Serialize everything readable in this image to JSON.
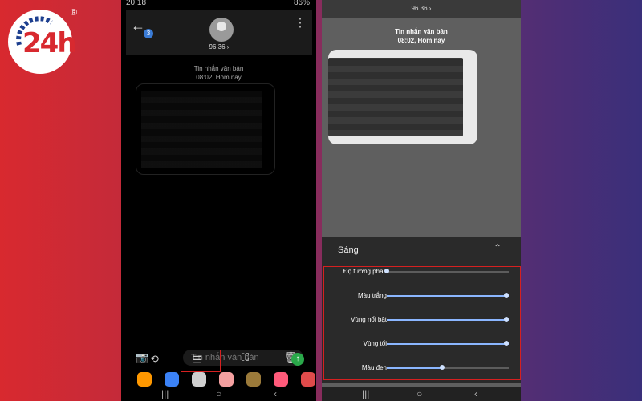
{
  "logo": {
    "brand_text": "24h",
    "reg": "®"
  },
  "left_phone": {
    "status": {
      "time": "20:18",
      "battery": "86%"
    },
    "header": {
      "contact": "96 36 ›",
      "badge": "3"
    },
    "thread_meta": {
      "title": "Tin nhắn văn bản",
      "time": "08:02, Hôm nay"
    },
    "composer": {
      "placeholder": "Tin nhắn văn bản"
    },
    "icons": {
      "back": "back-arrow-icon",
      "menu": "more-vert-icon",
      "camera": "camera-icon",
      "share": "share-icon",
      "adjust": "sliders-icon",
      "crop": "crop-icon",
      "delete": "trash-icon",
      "send": "send-icon"
    },
    "nav": {
      "recent": "|||",
      "home": "○",
      "back": "‹"
    }
  },
  "right_phone": {
    "top": {
      "contact": "96 36 ›"
    },
    "thread_meta": {
      "title": "Tin nhắn văn bản",
      "time": "08:02, Hôm nay"
    },
    "panel": {
      "title": "Sáng",
      "sliders": [
        {
          "label": "Độ tương phản",
          "value": 0
        },
        {
          "label": "Màu trắng",
          "value": 1
        },
        {
          "label": "Vùng nổi bật",
          "value": 1
        },
        {
          "label": "Vùng tối",
          "value": 1
        },
        {
          "label": "Màu đen",
          "value": 0.45
        }
      ]
    },
    "nav": {
      "recent": "|||",
      "home": "○",
      "back": "‹"
    }
  },
  "colors": {
    "accent": "#8bb6ff",
    "highlight": "#d62020"
  }
}
